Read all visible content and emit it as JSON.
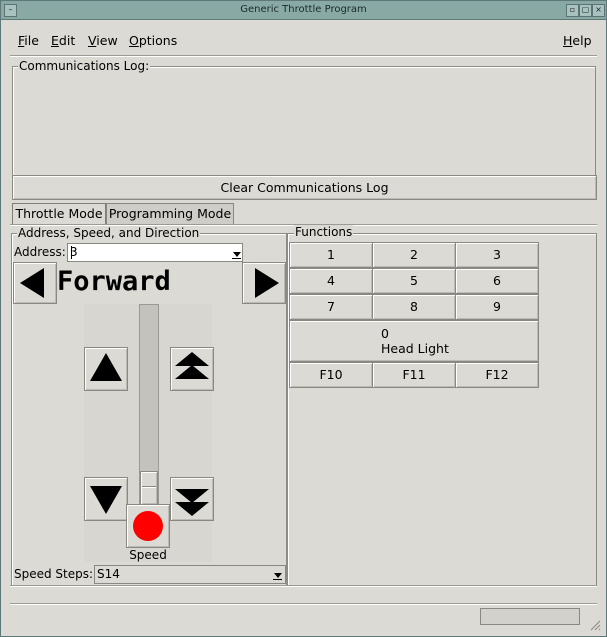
{
  "window": {
    "title": "Generic Throttle Program"
  },
  "menu": {
    "file": "File",
    "edit": "Edit",
    "view": "View",
    "options": "Options",
    "help": "Help"
  },
  "comm_log": {
    "label": "Communications Log:",
    "clear_button": "Clear Communications Log"
  },
  "tabs": [
    {
      "label": "Throttle Mode",
      "active": true
    },
    {
      "label": "Programming Mode",
      "active": false
    }
  ],
  "throttle": {
    "group_label": "Address, Speed, and Direction",
    "address_label": "Address:",
    "address_value": "3",
    "direction": "Forward",
    "speed_label": "Speed",
    "speed_value_fraction": 0.0,
    "speed_steps_label": "Speed Steps:",
    "speed_steps_value": "S14"
  },
  "functions": {
    "group_label": "Functions",
    "rows": [
      [
        "1",
        "2",
        "3"
      ],
      [
        "4",
        "5",
        "6"
      ],
      [
        "7",
        "8",
        "9"
      ]
    ],
    "f0_number": "0",
    "f0_name": "Head Light",
    "bottom": [
      "F10",
      "F11",
      "F12"
    ]
  },
  "colors": {
    "titlebar": "#88a9a4",
    "stop": "#ff0000",
    "bg": "#dcdad5"
  },
  "icons": [
    "window-menu-icon",
    "minimize-icon",
    "maximize-icon",
    "close-icon",
    "left-arrow-icon",
    "right-arrow-icon",
    "up-arrow-icon",
    "double-up-arrow-icon",
    "down-arrow-icon",
    "double-down-arrow-icon",
    "stop-icon"
  ]
}
